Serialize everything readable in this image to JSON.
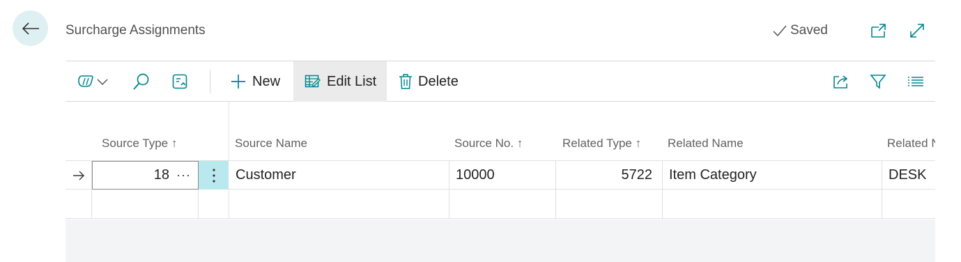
{
  "header": {
    "title": "Surcharge Assignments",
    "saved_label": "Saved"
  },
  "toolbar": {
    "new_label": "New",
    "edit_list_label": "Edit List",
    "delete_label": "Delete"
  },
  "grid": {
    "columns": [
      {
        "label": "Source Type",
        "sort": "↑"
      },
      {
        "label": "Source Name",
        "sort": ""
      },
      {
        "label": "Source No.",
        "sort": "↑"
      },
      {
        "label": "Related Type",
        "sort": "↑"
      },
      {
        "label": "Related Name",
        "sort": ""
      },
      {
        "label": "Related N",
        "sort": ""
      }
    ],
    "rows": [
      {
        "source_type": "18",
        "source_name": "Customer",
        "source_no": "10000",
        "related_type": "5722",
        "related_name": "Item Category",
        "related_no": "DESK"
      }
    ],
    "more_dots": "···"
  },
  "colors": {
    "accent": "#00838f",
    "back_button_bg": "#dff0f2",
    "row_menu_bg": "#b9e9ee"
  }
}
